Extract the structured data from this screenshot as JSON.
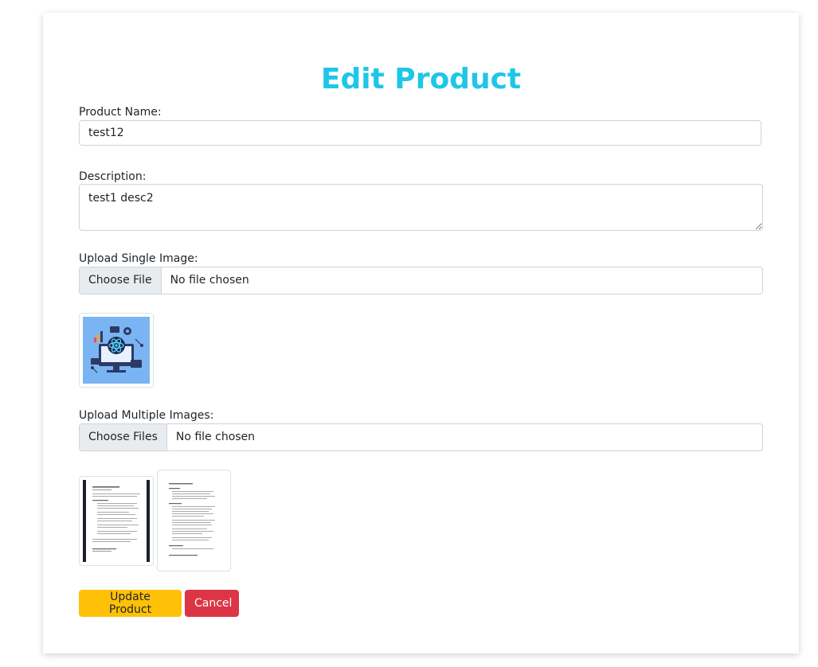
{
  "page": {
    "title": "Edit Product"
  },
  "form": {
    "name_label": "Product Name:",
    "name_value": "test12",
    "description_label": "Description:",
    "description_value": "test1 desc2",
    "single_image_label": "Upload Single Image:",
    "single_image_button": "Choose File",
    "single_image_status": "No file chosen",
    "multiple_images_label": "Upload Multiple Images:",
    "multiple_images_button": "Choose Files",
    "multiple_images_status": "No file chosen"
  },
  "actions": {
    "update_label": "Update Product",
    "cancel_label": "Cancel"
  },
  "colors": {
    "title": "#1fc6e8",
    "update_button": "#ffc107",
    "cancel_button": "#dc3545",
    "image_background": "#7bb4f2"
  }
}
